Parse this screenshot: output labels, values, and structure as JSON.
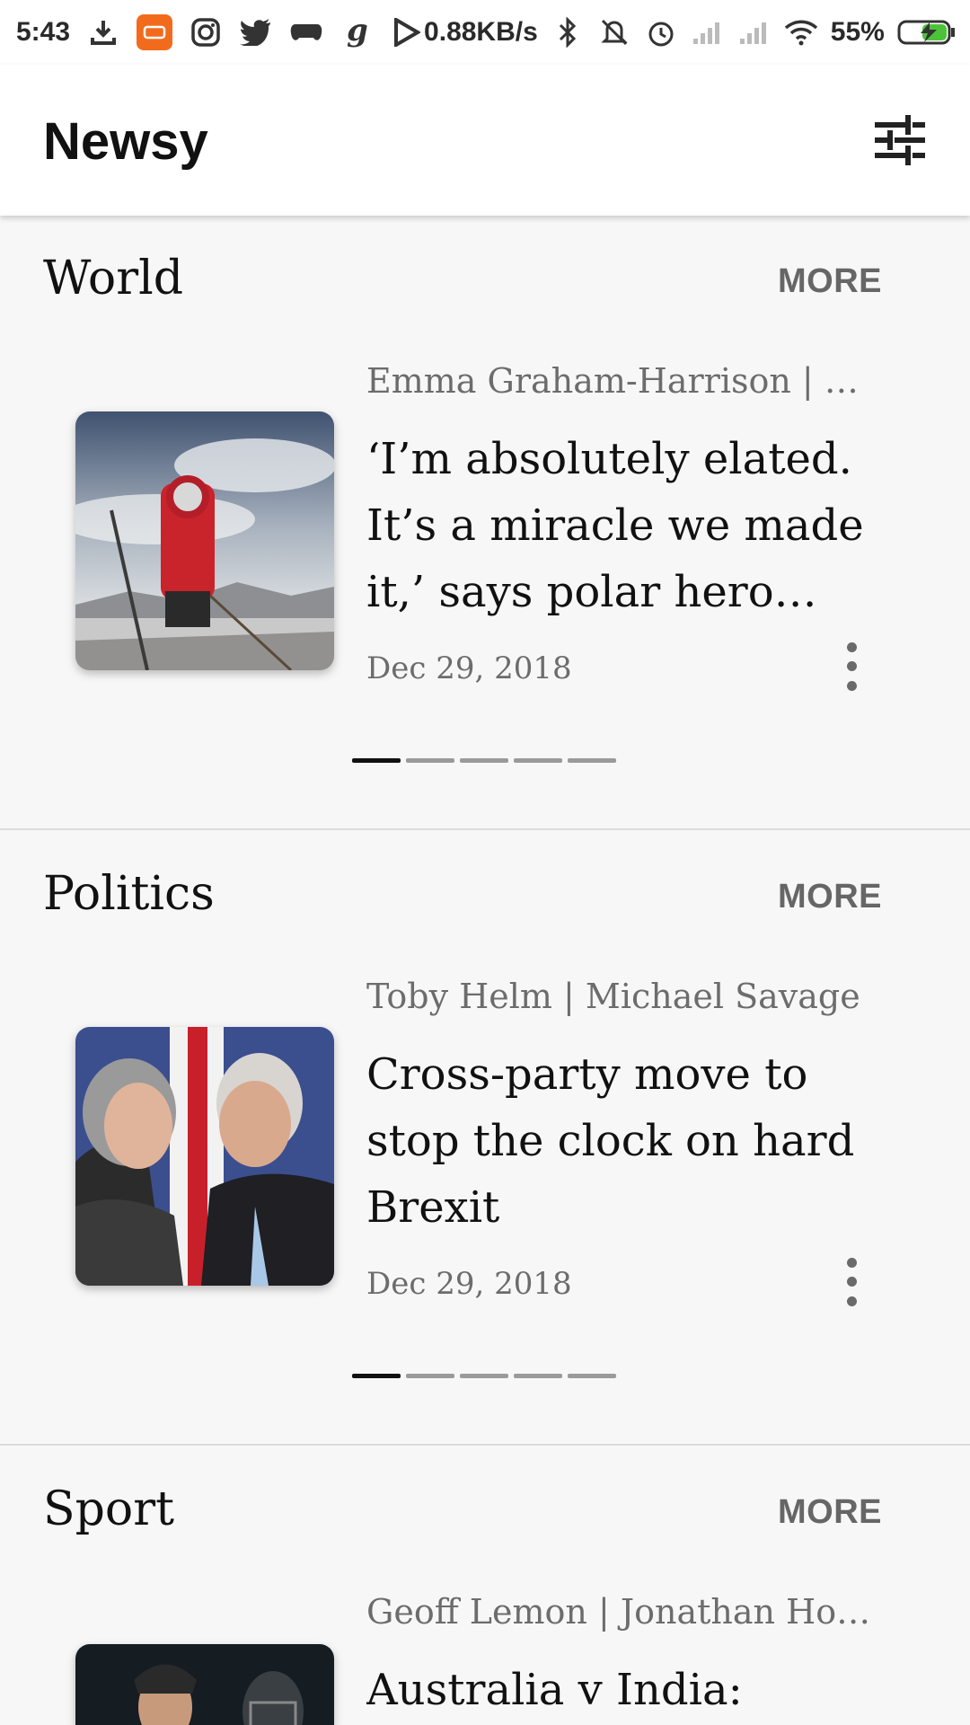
{
  "status_bar": {
    "time": "5:43",
    "net_speed": "0.88KB/s",
    "battery": "55%",
    "icons": [
      "download-icon",
      "mi-icon",
      "instagram-icon",
      "twitter-icon",
      "game-controller-icon",
      "g-app-icon",
      "play-store-icon",
      "bluetooth-icon",
      "mute-icon",
      "alarm-icon",
      "signal-icon",
      "signal-icon",
      "wifi-icon",
      "battery-charging-icon"
    ]
  },
  "app_bar": {
    "title": "Newsy",
    "filter_icon": "tune-icon"
  },
  "sections": [
    {
      "title": "World",
      "more_label": "MORE",
      "article": {
        "byline": "Emma Graham-Harrison | Lou Rudd",
        "headline": "‘I’m absolutely elated. It’s a miracle we made it,’ says polar hero Louis Rudd",
        "date": "Dec 29, 2018",
        "image": "polar-explorer-photo"
      },
      "pager": {
        "count": 5,
        "active": 1
      }
    },
    {
      "title": "Politics",
      "more_label": "MORE",
      "article": {
        "byline": "Toby Helm | Michael Savage",
        "headline": "Cross-party move to stop the clock on hard Brexit",
        "date": "Dec 29, 2018",
        "image": "politicians-photo"
      },
      "pager": {
        "count": 5,
        "active": 1
      }
    },
    {
      "title": "Sport",
      "more_label": "MORE",
      "article": {
        "byline": "Geoff Lemon | Jonathan Howcroft",
        "headline": "Australia v India:",
        "image": "cricket-photo"
      }
    }
  ],
  "colors": {
    "background": "#f7f7f7",
    "appbar": "#ffffff",
    "text_primary": "#111111",
    "text_secondary": "#6c6c6c",
    "pager_active": "#111111",
    "pager_inactive": "#9a9a9a"
  }
}
